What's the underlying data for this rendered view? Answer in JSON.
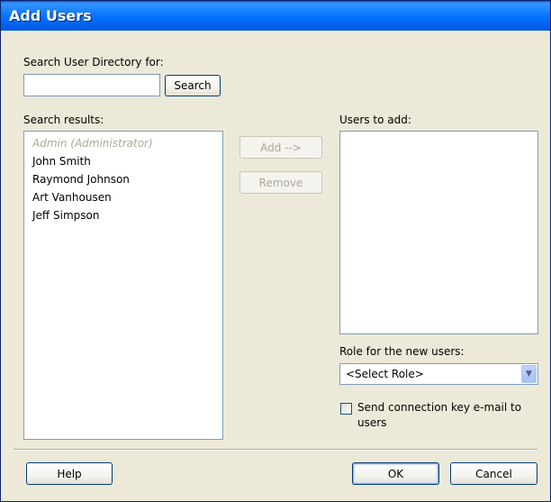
{
  "window": {
    "title": "Add Users"
  },
  "search": {
    "label": "Search User Directory for:",
    "value": "",
    "button_label": "Search"
  },
  "results": {
    "label": "Search results:",
    "items": [
      {
        "name": "Admin (Administrator)",
        "disabled": true
      },
      {
        "name": "John Smith",
        "disabled": false
      },
      {
        "name": "Raymond Johnson",
        "disabled": false
      },
      {
        "name": "Art Vanhousen",
        "disabled": false
      },
      {
        "name": "Jeff Simpson",
        "disabled": false
      }
    ]
  },
  "actions": {
    "add_label": "Add -->",
    "remove_label": "Remove"
  },
  "users_to_add": {
    "label": "Users to add:",
    "items": []
  },
  "role": {
    "label": "Role for the new users:",
    "selected": "<Select Role>"
  },
  "send_key": {
    "label_line1": "Send connection key e-mail to",
    "label_line2": "users",
    "checked": false
  },
  "footer": {
    "help_label": "Help",
    "ok_label": "OK",
    "cancel_label": "Cancel"
  },
  "colors": {
    "title_bar": "#0058e6",
    "dialog_bg": "#ece9d8",
    "input_border": "#7f9db9",
    "disabled_text": "#aca899"
  }
}
